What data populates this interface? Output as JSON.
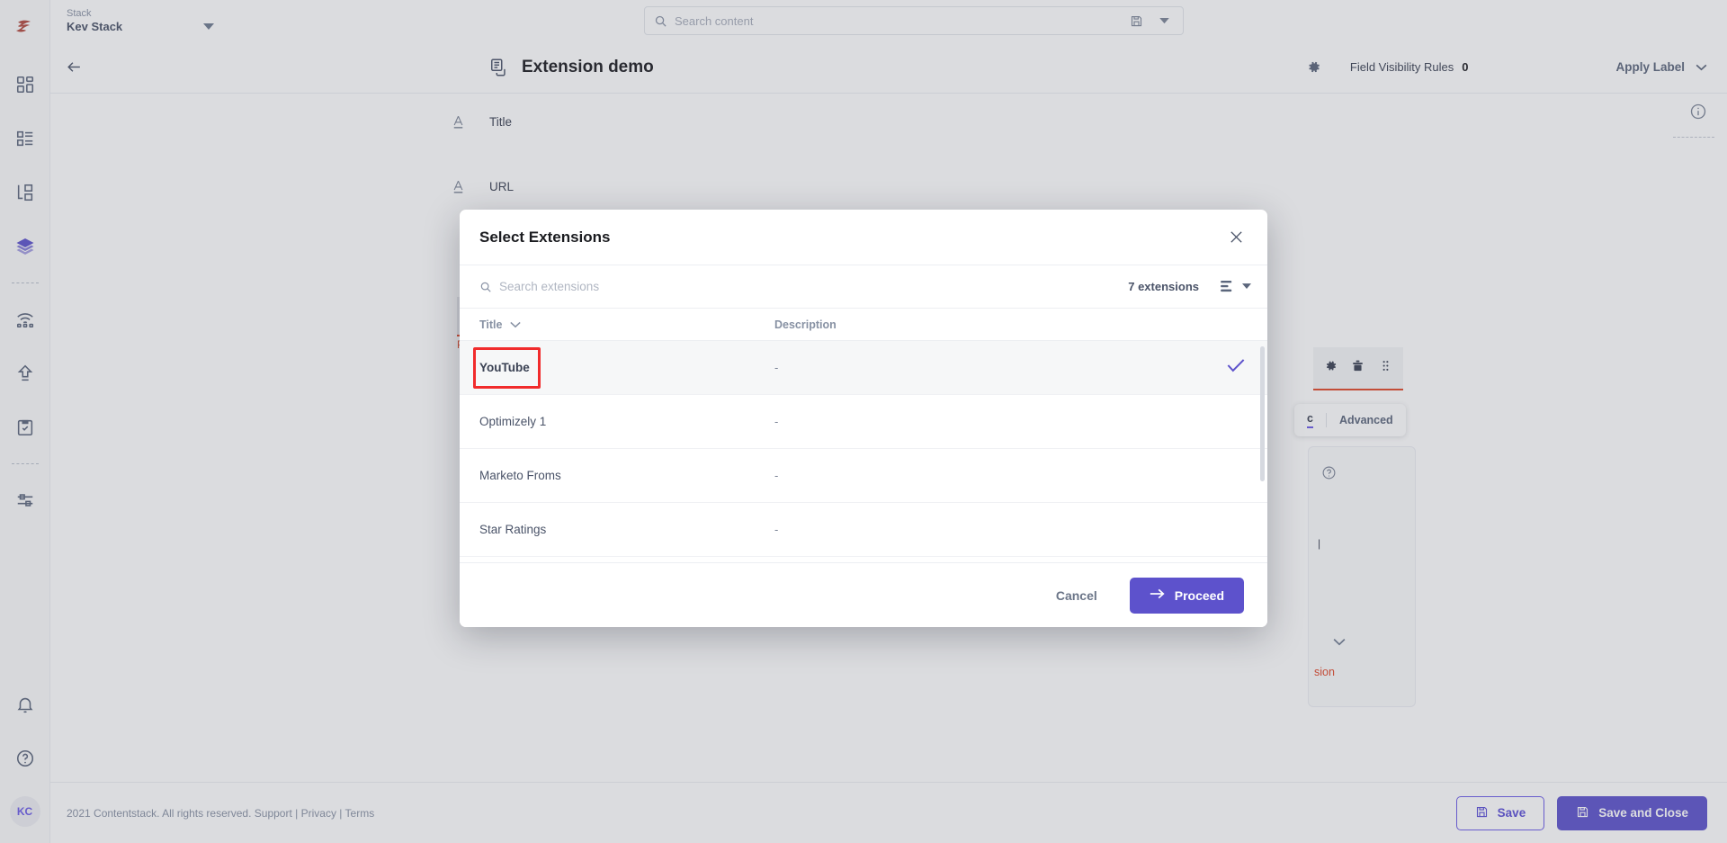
{
  "topbar": {
    "stack_label": "Stack",
    "stack_name": "Kev Stack",
    "search_placeholder": "Search content",
    "search_value": ""
  },
  "header": {
    "title": "Extension demo",
    "field_visibility_rules_label": "Field Visibility Rules",
    "field_visibility_rules_count": "0",
    "apply_label": "Apply Label"
  },
  "form": {
    "fields": [
      {
        "name": "Title"
      },
      {
        "name": "URL"
      }
    ],
    "error_text": "Plea",
    "panel_text": "sion",
    "tab_basic": "c",
    "tab_advanced": "Advanced"
  },
  "modal": {
    "title": "Select Extensions",
    "search_placeholder": "Search extensions",
    "search_value": "",
    "count_text": "7 extensions",
    "columns": {
      "title": "Title",
      "description": "Description"
    },
    "rows": [
      {
        "title": "YouTube",
        "description": "-",
        "selected": true
      },
      {
        "title": "Optimizely 1",
        "description": "-",
        "selected": false
      },
      {
        "title": "Marketo Froms",
        "description": "-",
        "selected": false
      },
      {
        "title": "Star Ratings",
        "description": "-",
        "selected": false
      }
    ],
    "cancel_label": "Cancel",
    "proceed_label": "Proceed"
  },
  "footer": {
    "copyright": "2021 Contentstack. All rights reserved. Support",
    "privacy": "Privacy",
    "terms": "Terms",
    "save_label": "Save",
    "save_close_label": "Save and Close"
  },
  "sidebar": {
    "avatar_initials": "KC"
  },
  "colors": {
    "accent": "#5d52cc",
    "highlight": "#f12b2c",
    "error": "#e0482a",
    "logo": "#b34a3f"
  }
}
